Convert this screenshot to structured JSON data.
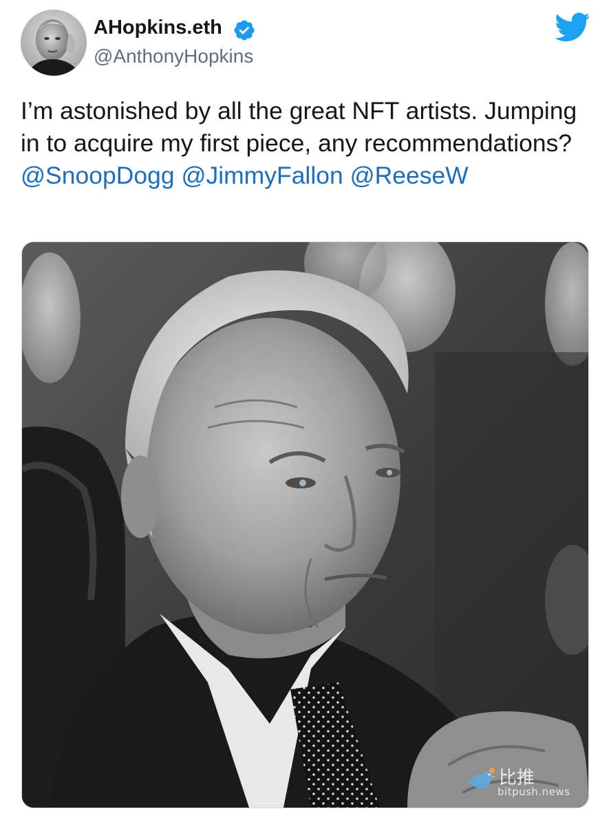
{
  "tweet": {
    "display_name": "AHopkins.eth",
    "handle": "@AnthonyHopkins",
    "verified": true,
    "text_parts": [
      "I’m astonished by all the great NFT artists. Jumping in to acquire my first piece, any recommendations? ",
      "@SnoopDogg",
      " ",
      "@JimmyFallon",
      " ",
      "@ReeseW"
    ],
    "mentions": [
      "@SnoopDogg",
      "@JimmyFallon",
      "@ReeseW"
    ],
    "avatar_icon": "profile-photo",
    "platform_icon": "twitter-bird-icon",
    "verified_icon": "verified-badge-icon",
    "media_description_icon": "attached-photo"
  },
  "watermark": {
    "chinese": "比推",
    "latin": "bitpush.news"
  },
  "colors": {
    "twitter_blue": "#1da1f2",
    "mention_blue": "#1b6dc1",
    "text": "#14171a",
    "muted": "#5b7083"
  }
}
